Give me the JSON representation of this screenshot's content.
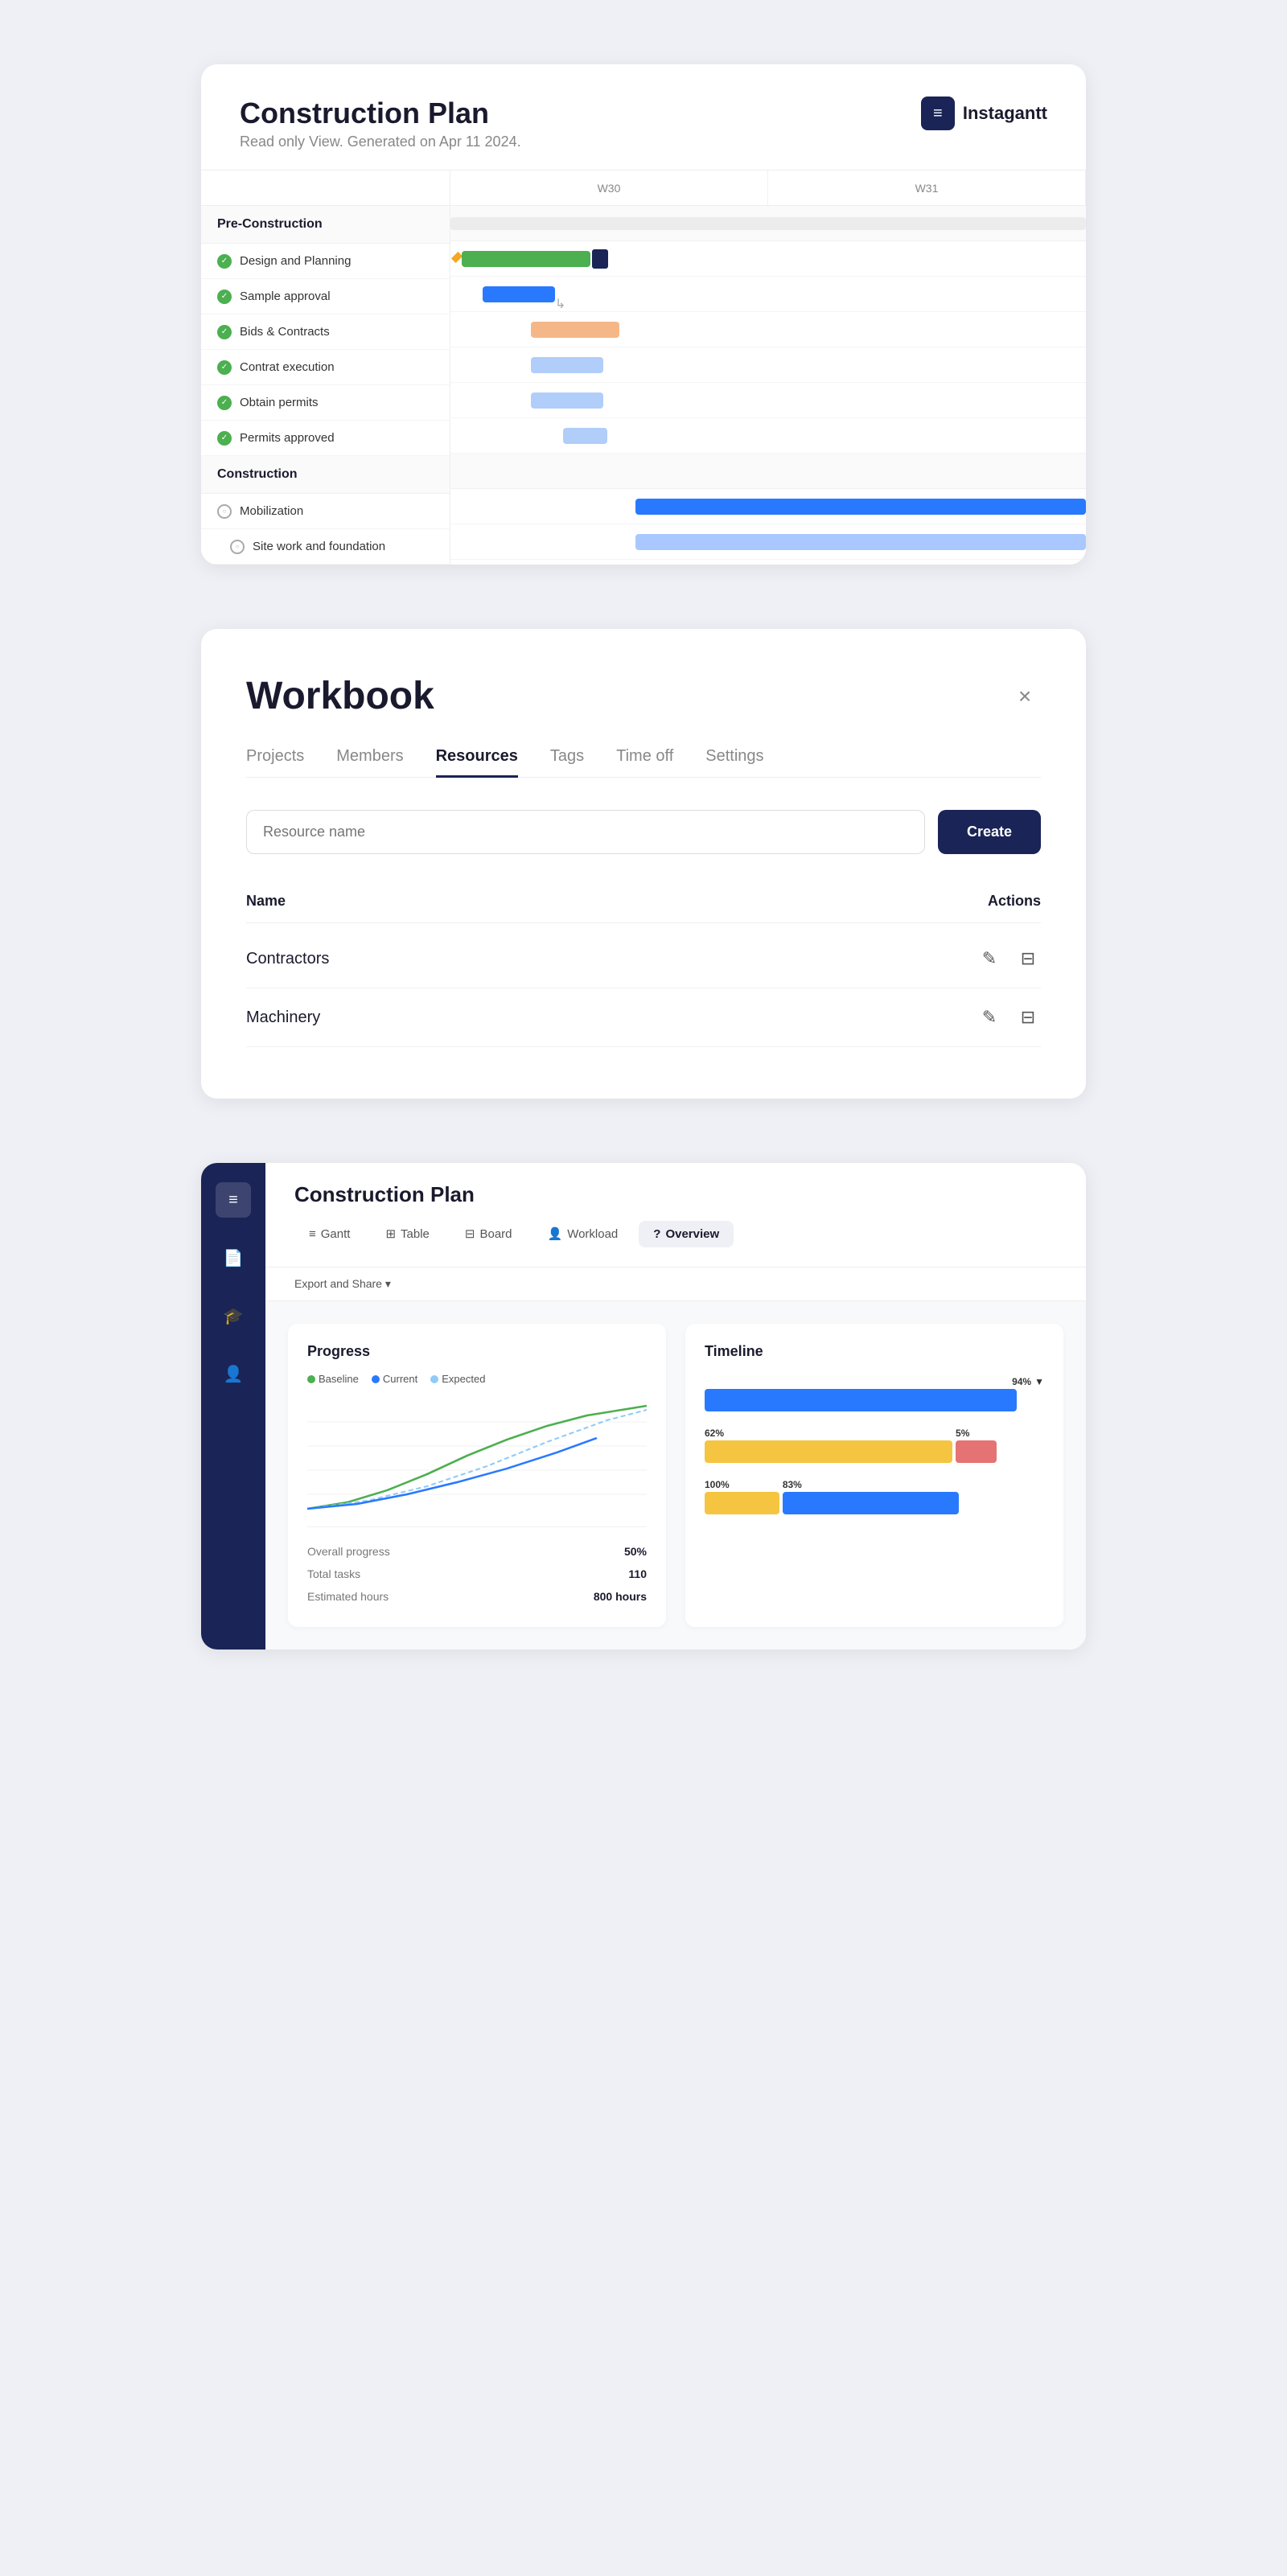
{
  "card1": {
    "title": "Construction Plan",
    "subtitle": "Read only View. Generated on Apr 11 2024.",
    "logo_text": "Instagantt",
    "weeks": [
      "W30",
      "W31"
    ],
    "groups": [
      {
        "name": "Pre-Construction",
        "tasks": [
          {
            "label": "Design and Planning",
            "check": "solid"
          },
          {
            "label": "Sample approval",
            "check": "solid"
          },
          {
            "label": "Bids & Contracts",
            "check": "solid"
          },
          {
            "label": "Contrat execution",
            "check": "solid"
          },
          {
            "label": "Obtain permits",
            "check": "solid"
          },
          {
            "label": "Permits approved",
            "check": "solid"
          }
        ]
      },
      {
        "name": "Construction",
        "tasks": [
          {
            "label": "Mobilization",
            "check": "outline"
          },
          {
            "label": "Site work and foundation",
            "check": "outline",
            "sub": true
          }
        ]
      }
    ]
  },
  "card2": {
    "title": "Workbook",
    "close_label": "×",
    "tabs": [
      "Projects",
      "Members",
      "Resources",
      "Tags",
      "Time off",
      "Settings"
    ],
    "active_tab": "Resources",
    "search_placeholder": "Resource name",
    "create_label": "Create",
    "table_headers": {
      "name": "Name",
      "actions": "Actions"
    },
    "resources": [
      {
        "name": "Contractors"
      },
      {
        "name": "Machinery"
      }
    ]
  },
  "card3": {
    "plan_title": "Construction Plan",
    "sidebar_icons": [
      "≡",
      "📄",
      "🎓",
      "👤"
    ],
    "tabs": [
      {
        "label": "Gantt",
        "icon": "≡"
      },
      {
        "label": "Table",
        "icon": "⊞"
      },
      {
        "label": "Board",
        "icon": "⊟"
      },
      {
        "label": "Workload",
        "icon": "👤"
      },
      {
        "label": "Overview",
        "icon": "?"
      }
    ],
    "active_tab": "Overview",
    "toolbar_label": "Export and Share ▾",
    "panels": {
      "progress": {
        "title": "Progress",
        "legend": [
          {
            "label": "Baseline",
            "color": "#4caf50"
          },
          {
            "label": "Current",
            "color": "#2979ff"
          },
          {
            "label": "Expected",
            "color": "#90caf9"
          }
        ],
        "stats": [
          {
            "label": "Overall progress",
            "value": "50%"
          },
          {
            "label": "Total tasks",
            "value": "110"
          },
          {
            "label": "Estimated hours",
            "value": "800 hours"
          }
        ]
      },
      "timeline": {
        "title": "Timeline",
        "bars": [
          {
            "pct": "94%",
            "color": "#2979ff",
            "width": 90
          },
          {
            "pct1": "62%",
            "pct2": "5%",
            "color1": "#f5c542",
            "color2": "#e57373",
            "w1": 75,
            "w2": 12
          },
          {
            "pct1": "100%",
            "pct2": "83%",
            "color1": "#f5c542",
            "color2": "#2979ff",
            "w1": 24,
            "w2": 52
          }
        ]
      }
    }
  }
}
